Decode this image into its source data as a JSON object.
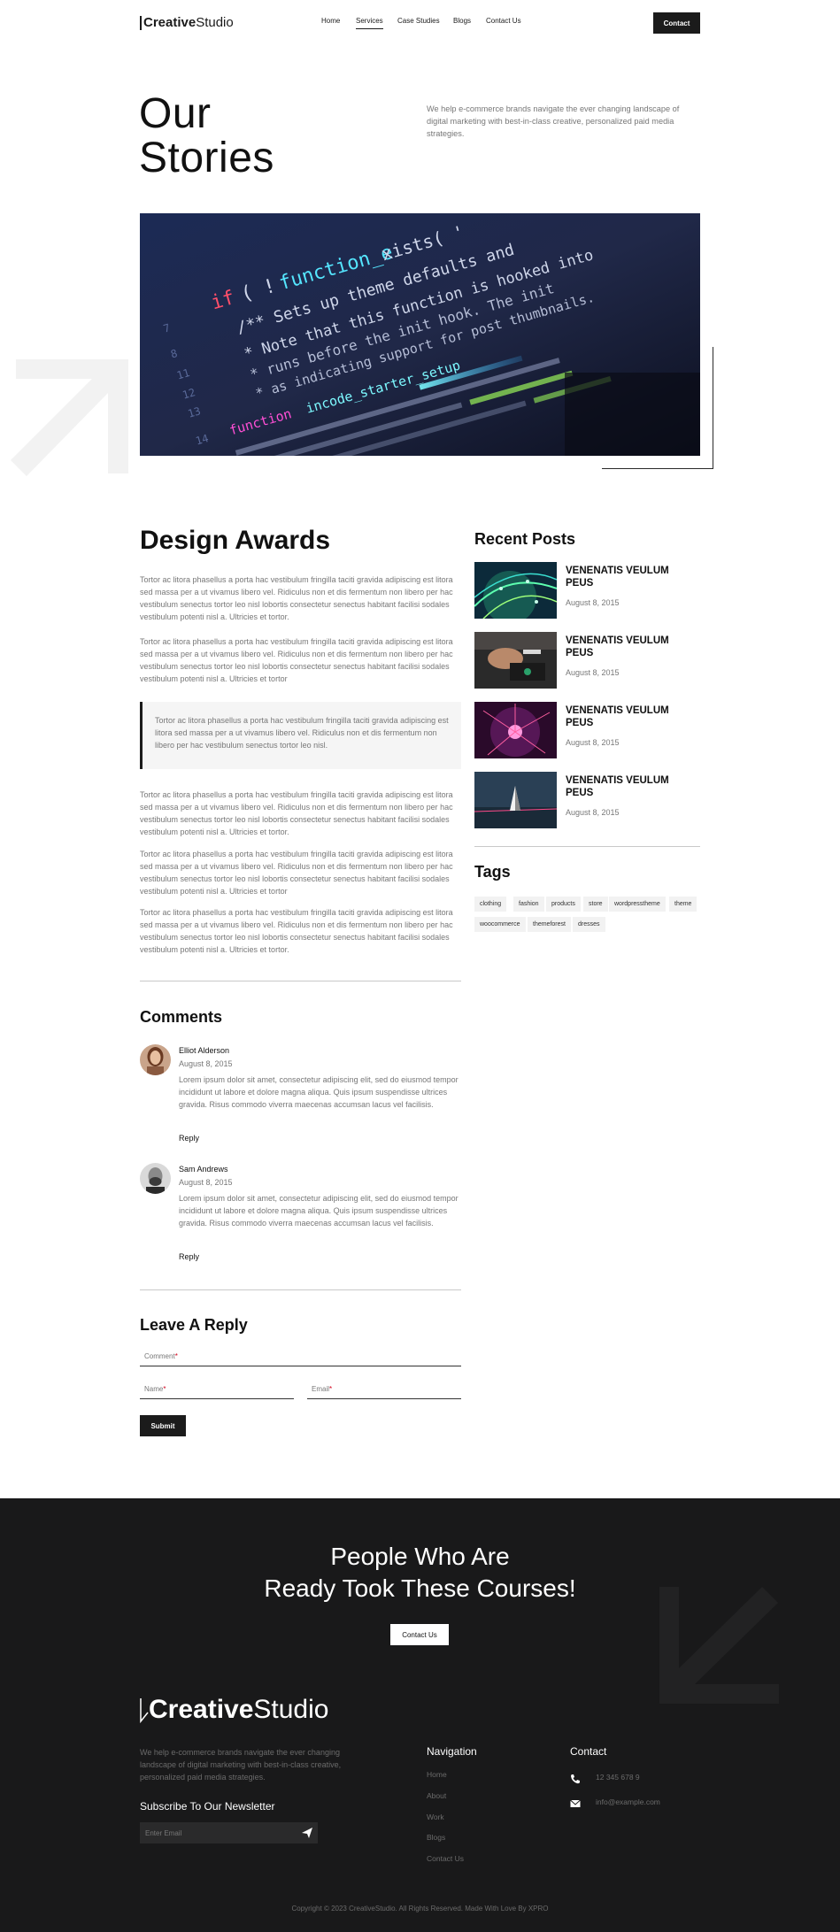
{
  "header": {
    "logo_bold": "Creative",
    "logo_light": "Studio",
    "nav": [
      "Home",
      "Services",
      "Case Studies",
      "Blogs",
      "Contact Us"
    ],
    "active_nav": "Services",
    "contact_button": "Contact"
  },
  "hero": {
    "title_line1": "Our",
    "title_line2": "Stories",
    "description": "We help e-commerce brands navigate the ever changing landscape of digital marketing with best-in-class creative, personalized paid media strategies."
  },
  "article": {
    "title": "Design Awards",
    "paragraphs": [
      "Tortor ac litora phasellus a porta hac vestibulum fringilla taciti gravida adipiscing est litora sed massa per a ut vivamus libero vel. Ridiculus non et dis fermentum non libero per hac vestibulum senectus tortor leo nisl lobortis consectetur senectus habitant facilisi sodales vestibulum potenti nisl a. Ultricies et tortor.",
      "Tortor ac litora phasellus a porta hac vestibulum fringilla taciti gravida adipiscing est litora sed massa per a ut vivamus libero vel. Ridiculus non et dis fermentum non libero per hac vestibulum senectus tortor leo nisl lobortis consectetur senectus habitant facilisi sodales vestibulum potenti nisl a. Ultricies et tortor",
      "Tortor ac litora phasellus a porta hac vestibulum fringilla taciti gravida adipiscing est litora sed massa per a ut vivamus libero vel. Ridiculus non et dis fermentum non libero per hac vestibulum senectus tortor leo nisl lobortis consectetur senectus habitant facilisi sodales vestibulum potenti nisl a. Ultricies et tortor.",
      "Tortor ac litora phasellus a porta hac vestibulum fringilla taciti gravida adipiscing est litora sed massa per a ut vivamus libero vel. Ridiculus non et dis fermentum non libero per hac vestibulum senectus tortor leo nisl lobortis consectetur senectus habitant facilisi sodales vestibulum potenti nisl a. Ultricies et tortor",
      "Tortor ac litora phasellus a porta hac vestibulum fringilla taciti gravida adipiscing est litora sed massa per a ut vivamus libero vel. Ridiculus non et dis fermentum non libero per hac vestibulum senectus tortor leo nisl lobortis consectetur senectus habitant facilisi sodales vestibulum potenti nisl a. Ultricies et tortor."
    ],
    "quote": "Tortor ac litora phasellus a porta hac vestibulum fringilla taciti gravida adipiscing est litora sed massa per a ut vivamus libero vel. Ridiculus non et dis fermentum non libero per hac vestibulum senectus tortor leo nisl."
  },
  "sidebar": {
    "recent_title": "Recent Posts",
    "posts": [
      {
        "title": "VENENATIS VEULUM PEUS",
        "date": "August 8, 2015"
      },
      {
        "title": "VENENATIS VEULUM PEUS",
        "date": "August 8, 2015"
      },
      {
        "title": "VENENATIS VEULUM PEUS",
        "date": "August 8, 2015"
      },
      {
        "title": "VENENATIS VEULUM PEUS",
        "date": "August 8, 2015"
      }
    ],
    "tags_title": "Tags",
    "tags": [
      "clothing",
      "fashion",
      "products",
      "store",
      "wordpresstheme",
      "theme",
      "woocommerce",
      "themeforest",
      "dresses"
    ]
  },
  "comments": {
    "title": "Comments",
    "items": [
      {
        "name": "Elliot Alderson",
        "date": "August 8, 2015",
        "text": "Lorem ipsum dolor sit amet, consectetur adipiscing elit, sed do eiusmod tempor incididunt ut labore et dolore magna aliqua. Quis ipsum suspendisse ultrices gravida. Risus commodo viverra maecenas accumsan lacus vel facilisis.",
        "reply": "Reply"
      },
      {
        "name": "Sam Andrews",
        "date": "August 8, 2015",
        "text": "Lorem ipsum dolor sit amet, consectetur adipiscing elit, sed do eiusmod tempor incididunt ut labore et dolore magna aliqua. Quis ipsum suspendisse ultrices gravida. Risus commodo viverra maecenas accumsan lacus vel facilisis.",
        "reply": "Reply"
      }
    ]
  },
  "reply_form": {
    "title": "Leave A Reply",
    "comment_placeholder": "Comment",
    "name_placeholder": "Name",
    "email_placeholder": "Email",
    "required_mark": "*",
    "submit": "Submit"
  },
  "footer": {
    "cta_line1": "People Who Are",
    "cta_line2": "Ready Took These Courses!",
    "cta_button": "Contact Us",
    "logo_bold": "Creative",
    "logo_light": "Studio",
    "description": "We help e-commerce brands navigate the ever changing landscape of digital marketing with best-in-class creative, personalized paid media strategies.",
    "newsletter_title": "Subscribe To Our Newsletter",
    "email_placeholder": "Enter Email",
    "nav_title": "Navigation",
    "nav_links": [
      "Home",
      "About",
      "Work",
      "Blogs",
      "Contact Us"
    ],
    "contact_title": "Contact",
    "phone": "12 345 678 9",
    "email": "info@example.com",
    "copyright": "Copyright © 2023 CreativeStudio. All Rights Reserved. Made With Love By XPRO"
  },
  "colors": {
    "dark": "#1b1b1b",
    "footer_bg": "#19191a",
    "muted_text": "#777777",
    "required": "#d0021b"
  }
}
